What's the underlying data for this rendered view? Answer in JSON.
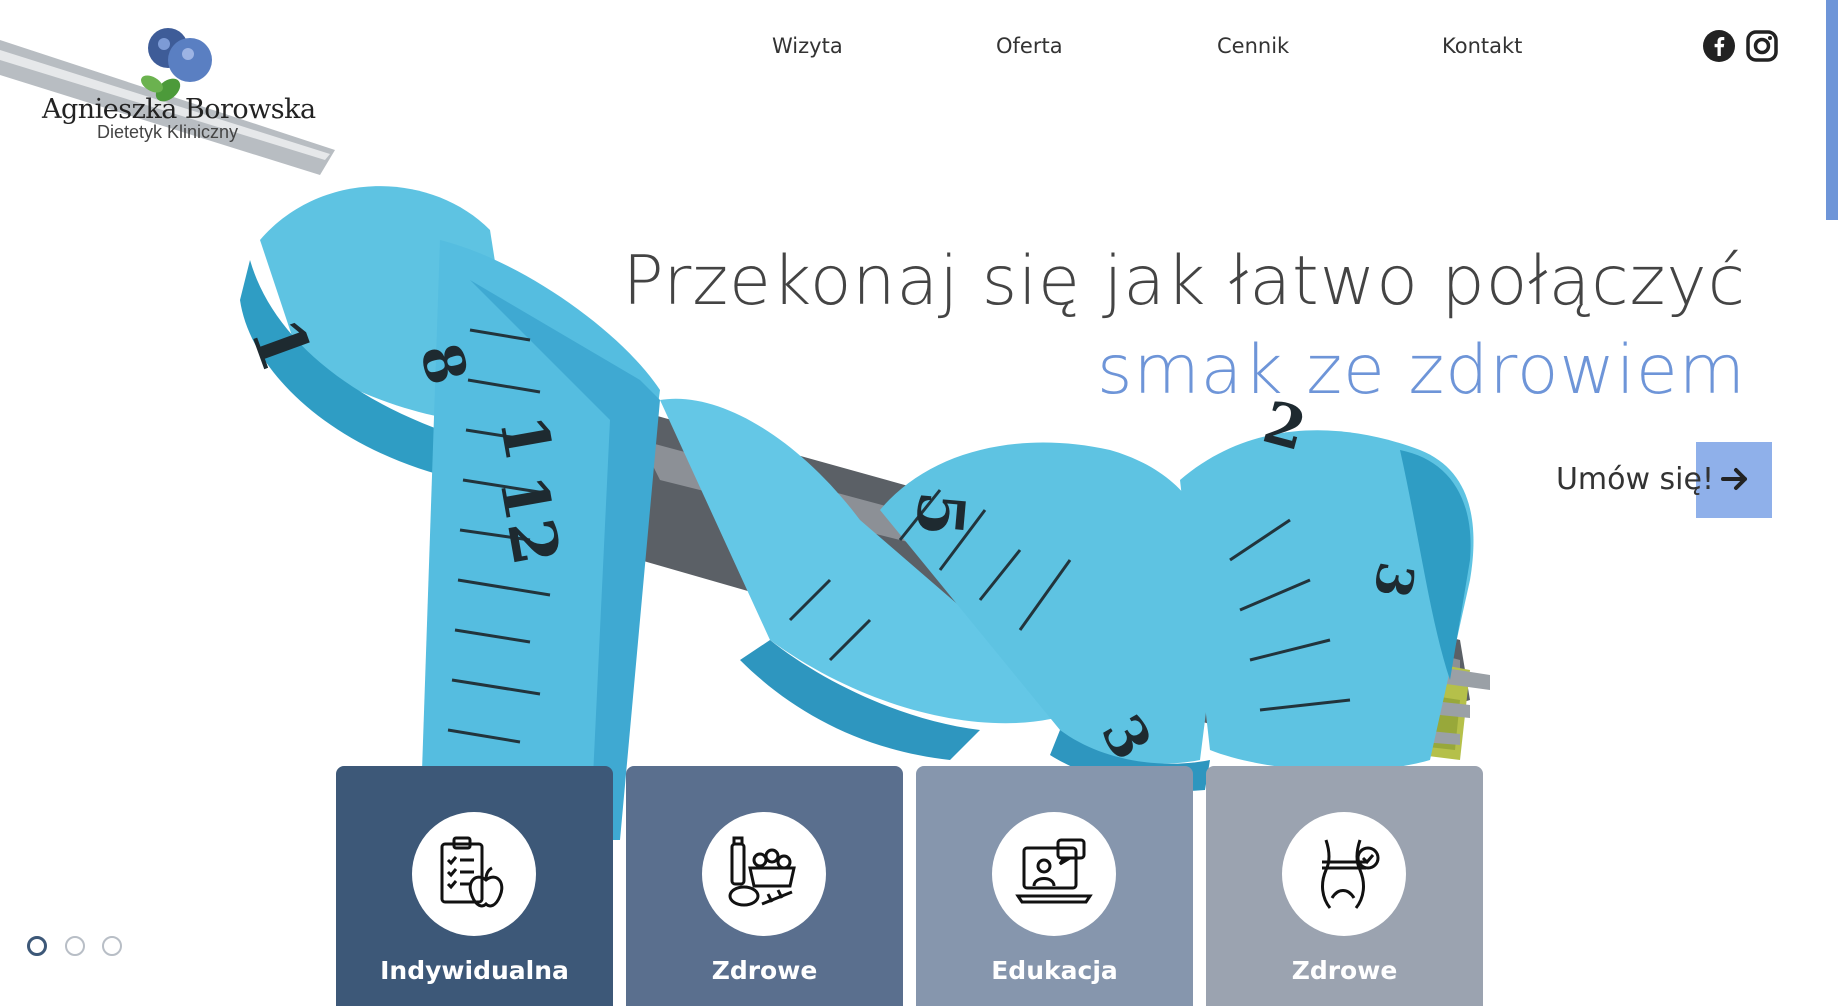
{
  "logo": {
    "name": "Agnieszka Borowska",
    "subtitle": "Dietetyk Kliniczny"
  },
  "nav": {
    "items": [
      "Wizyta",
      "Oferta",
      "Cennik",
      "Kontakt"
    ]
  },
  "social": {
    "facebook_icon": "facebook-icon",
    "instagram_icon": "instagram-icon"
  },
  "hero": {
    "headline_line1": "Przekonaj się jak łatwo połączyć",
    "headline_line2": "smak ze zdrowiem",
    "cta_label": "Umów się!",
    "cta_icon": "arrow-right-icon"
  },
  "cards": [
    {
      "title": "Indywidualna",
      "icon": "diet-plan-apple-icon",
      "color": "#3d5878"
    },
    {
      "title": "Zdrowe",
      "icon": "healthy-groceries-icon",
      "color": "#5a6f8e"
    },
    {
      "title": "Edukacja",
      "icon": "online-consultation-icon",
      "color": "#8696ad"
    },
    {
      "title": "Zdrowe",
      "icon": "body-measurement-icon",
      "color": "#9ba3b0"
    }
  ],
  "slider": {
    "dot_count": 3,
    "active_index": 0
  },
  "colors": {
    "accent": "#6e95d8",
    "cta": "#8fb0ea",
    "text": "#444444"
  }
}
